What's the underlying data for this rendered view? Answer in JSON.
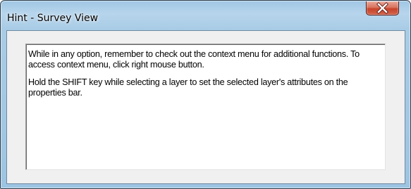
{
  "window": {
    "title": "Hint - Survey View"
  },
  "titlebar": {
    "close_icon": "close-icon"
  },
  "hint": {
    "paragraphs": [
      "While in any option, remember to check out the context menu for additional functions. To access context menu, click right mouse button.",
      "Hold the SHIFT key while selecting a layer to set the selected layer's attributes on the properties bar."
    ]
  },
  "colors": {
    "close_button": "#c7432a",
    "titlebar": "#a9cce6",
    "client_background": "#f0f0f0"
  }
}
